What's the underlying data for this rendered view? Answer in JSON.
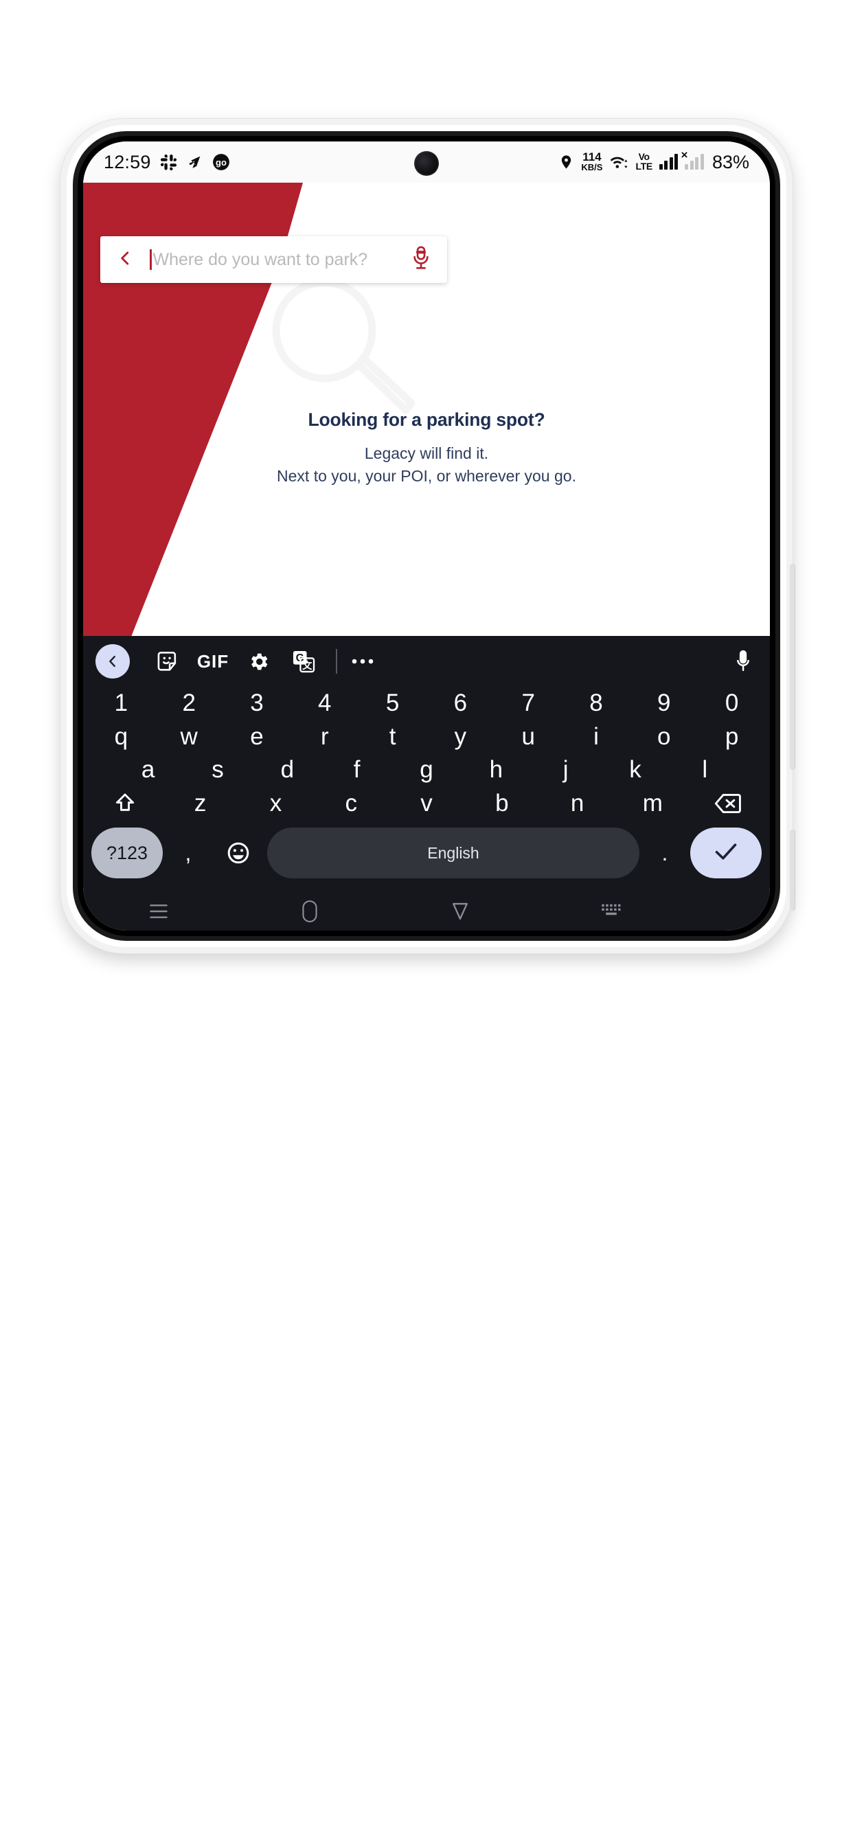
{
  "status_bar": {
    "clock": "12:59",
    "left_icons": [
      "slack-icon",
      "send-arrow-icon",
      "go-badge-icon"
    ],
    "net_speed_value": "114",
    "net_speed_unit": "KB/S",
    "location_icon": "location-pin-icon",
    "wifi_icon": "wifi-icon",
    "volte_top": "Vo",
    "volte_bottom": "LTE",
    "signal_icon": "signal-bars-icon",
    "sim2_icon": "signal-bars-no-service-icon",
    "sim2_marker": "×",
    "battery": "83%"
  },
  "app": {
    "brand_red": "#b3202e",
    "navy": "#1f2f52",
    "search": {
      "back_icon": "chevron-left-icon",
      "placeholder": "Where do you want to park?",
      "value": "",
      "mic_icon": "microphone-icon"
    },
    "watermark_icon": "magnifier-watermark-icon",
    "empty_state": {
      "title": "Looking for a parking spot?",
      "line1": "Legacy will find it.",
      "line2": "Next to you, your POI, or wherever you go."
    }
  },
  "keyboard": {
    "toolbar": {
      "back_icon": "chevron-left-icon",
      "sticker_icon": "sticker-icon",
      "gif_label": "GIF",
      "settings_icon": "gear-icon",
      "translate_icon": "google-translate-icon",
      "more_icon": "more-horizontal-icon",
      "mic_icon": "microphone-icon"
    },
    "row_numbers": [
      "1",
      "2",
      "3",
      "4",
      "5",
      "6",
      "7",
      "8",
      "9",
      "0"
    ],
    "row_letters_1": [
      "q",
      "w",
      "e",
      "r",
      "t",
      "y",
      "u",
      "i",
      "o",
      "p"
    ],
    "row_letters_2": [
      "a",
      "s",
      "d",
      "f",
      "g",
      "h",
      "j",
      "k",
      "l"
    ],
    "row_letters_3": [
      "z",
      "x",
      "c",
      "v",
      "b",
      "n",
      "m"
    ],
    "shift_icon": "shift-icon",
    "backspace_icon": "backspace-icon",
    "bottom": {
      "symbols_label": "?123",
      "comma": ",",
      "emoji_icon": "emoji-smile-icon",
      "space_label": "English",
      "period": ".",
      "enter_icon": "check-icon"
    },
    "key_bg": "#16171c",
    "accent_lavender": "#d7dcf7"
  },
  "nav_bar": {
    "recents_icon": "recents-icon",
    "home_icon": "home-pill-icon",
    "back_icon": "back-chevron-icon",
    "keyboard_icon": "hide-keyboard-icon"
  }
}
